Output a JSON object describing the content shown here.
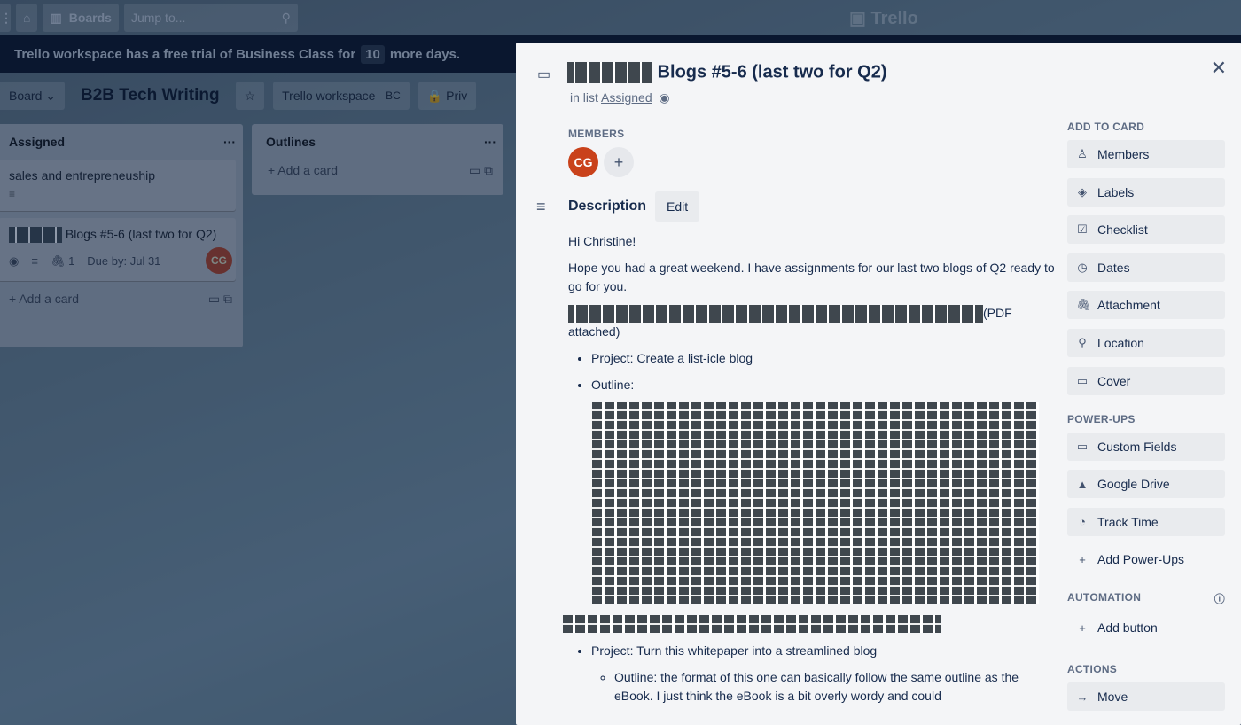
{
  "topbar": {
    "boards_label": "Boards",
    "search_placeholder": "Jump to...",
    "logo": "Trello"
  },
  "banner": {
    "text_before": "Trello workspace has a free trial of Business Class for",
    "days": "10",
    "text_after": "more days."
  },
  "boardbar": {
    "view_label": "Board",
    "title": "B2B Tech Writing",
    "workspace": "Trello workspace",
    "workspace_badge": "BC",
    "visibility": "Priv"
  },
  "lists": [
    {
      "title": "Assigned",
      "cards": [
        {
          "title": "sales and entrepreneuship"
        },
        {
          "title": "Blogs #5-6 (last two for Q2)",
          "attachments": "1",
          "due": "Due by: Jul 31",
          "member": "CG"
        }
      ],
      "add_label": "Add a card"
    },
    {
      "title": "Outlines",
      "add_label": "Add a card"
    }
  ],
  "card_modal": {
    "title": "Blogs #5-6 (last two for Q2)",
    "in_list_prefix": "in list",
    "list_name": "Assigned",
    "members_label": "MEMBERS",
    "member_initials": "CG",
    "description_label": "Description",
    "edit_label": "Edit",
    "description": {
      "greeting": "Hi Christine!",
      "intro": "Hope you had a great weekend. I have assignments for our last two blogs of Q2 ready to go for you.",
      "pdf_note": "(PDF attached)",
      "bullets1": [
        "Project: Create a list-icle blog",
        "Outline:"
      ],
      "bullets2": [
        "Project: Turn this whitepaper into a streamlined blog"
      ],
      "sub_bullet": "Outline: the format of this one can basically follow the same outline as the eBook. I just think the eBook is a bit overly wordy and could"
    },
    "sidebar": {
      "add_to_card_label": "ADD TO CARD",
      "add_to_card": [
        {
          "icon": "person-icon",
          "label": "Members"
        },
        {
          "icon": "tag-icon",
          "label": "Labels"
        },
        {
          "icon": "checklist-icon",
          "label": "Checklist"
        },
        {
          "icon": "clock-icon",
          "label": "Dates"
        },
        {
          "icon": "paperclip-icon",
          "label": "Attachment"
        },
        {
          "icon": "pin-icon",
          "label": "Location"
        },
        {
          "icon": "cover-icon",
          "label": "Cover"
        }
      ],
      "powerups_label": "POWER-UPS",
      "powerups": [
        {
          "icon": "custom-fields-icon",
          "label": "Custom Fields"
        },
        {
          "icon": "google-drive-icon",
          "label": "Google Drive"
        },
        {
          "icon": "track-time-icon",
          "label": "Track Time"
        },
        {
          "icon": "plus-icon",
          "label": "Add Power-Ups"
        }
      ],
      "automation_label": "AUTOMATION",
      "add_button_label": "Add button",
      "actions_label": "ACTIONS",
      "move_label": "Move"
    }
  }
}
